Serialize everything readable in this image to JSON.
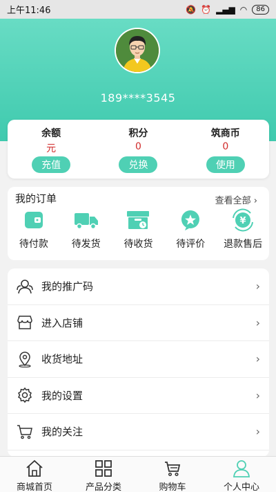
{
  "status_bar": {
    "time": "上午11:46",
    "battery": "86"
  },
  "profile": {
    "phone": "189****3545"
  },
  "balances": [
    {
      "title": "余额",
      "value": "元",
      "action": "充值"
    },
    {
      "title": "积分",
      "value": "0",
      "action": "兑换"
    },
    {
      "title": "筑商币",
      "value": "0",
      "action": "使用"
    }
  ],
  "orders": {
    "title": "我的订单",
    "view_all": "查看全部",
    "items": [
      {
        "label": "待付款",
        "icon": "wallet-icon"
      },
      {
        "label": "待发货",
        "icon": "truck-icon"
      },
      {
        "label": "待收货",
        "icon": "box-icon"
      },
      {
        "label": "待评价",
        "icon": "star-badge-icon"
      },
      {
        "label": "退款售后",
        "icon": "refund-yen-icon"
      }
    ]
  },
  "menu": [
    {
      "label": "我的推广码",
      "icon": "users-icon"
    },
    {
      "label": "进入店铺",
      "icon": "store-icon"
    },
    {
      "label": "收货地址",
      "icon": "location-pin-icon"
    },
    {
      "label": "我的设置",
      "icon": "gear-icon"
    },
    {
      "label": "我的关注",
      "icon": "cart-icon"
    }
  ],
  "tabbar": [
    {
      "label": "商城首页",
      "icon": "home-icon",
      "active": false
    },
    {
      "label": "产品分类",
      "icon": "grid-icon",
      "active": false
    },
    {
      "label": "购物车",
      "icon": "cart-icon",
      "active": false
    },
    {
      "label": "个人中心",
      "icon": "person-icon",
      "active": true
    }
  ],
  "colors": {
    "accent": "#4fd0b4",
    "header": "#4ecdb3",
    "value_red": "#d12b2b"
  }
}
